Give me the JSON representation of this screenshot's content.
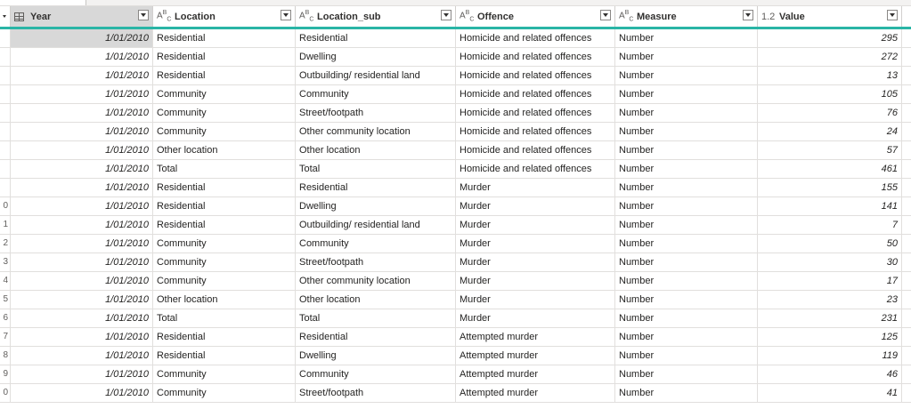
{
  "columns": [
    {
      "type_icon": "table-icon",
      "name": "Year"
    },
    {
      "type_icon": "text-type-icon",
      "name": "Location"
    },
    {
      "type_icon": "text-type-icon",
      "name": "Location_sub"
    },
    {
      "type_icon": "text-type-icon",
      "name": "Offence"
    },
    {
      "type_icon": "text-type-icon",
      "name": "Measure"
    },
    {
      "type_icon": "decimal-type-icon",
      "name": "Value"
    }
  ],
  "rows": [
    {
      "n": "",
      "year": "1/01/2010",
      "loc": "Residential",
      "sub": "Residential",
      "off": "Homicide and related offences",
      "meas": "Number",
      "val": "295"
    },
    {
      "n": "",
      "year": "1/01/2010",
      "loc": "Residential",
      "sub": "Dwelling",
      "off": "Homicide and related offences",
      "meas": "Number",
      "val": "272"
    },
    {
      "n": "",
      "year": "1/01/2010",
      "loc": "Residential",
      "sub": "Outbuilding/ residential land",
      "off": "Homicide and related offences",
      "meas": "Number",
      "val": "13"
    },
    {
      "n": "",
      "year": "1/01/2010",
      "loc": "Community",
      "sub": "Community",
      "off": "Homicide and related offences",
      "meas": "Number",
      "val": "105"
    },
    {
      "n": "",
      "year": "1/01/2010",
      "loc": "Community",
      "sub": "Street/footpath",
      "off": "Homicide and related offences",
      "meas": "Number",
      "val": "76"
    },
    {
      "n": "",
      "year": "1/01/2010",
      "loc": "Community",
      "sub": "Other community location",
      "off": "Homicide and related offences",
      "meas": "Number",
      "val": "24"
    },
    {
      "n": "",
      "year": "1/01/2010",
      "loc": "Other location",
      "sub": "Other location",
      "off": "Homicide and related offences",
      "meas": "Number",
      "val": "57"
    },
    {
      "n": "",
      "year": "1/01/2010",
      "loc": "Total",
      "sub": "Total",
      "off": "Homicide and related offences",
      "meas": "Number",
      "val": "461"
    },
    {
      "n": "",
      "year": "1/01/2010",
      "loc": "Residential",
      "sub": "Residential",
      "off": "Murder",
      "meas": "Number",
      "val": "155"
    },
    {
      "n": "0",
      "year": "1/01/2010",
      "loc": "Residential",
      "sub": "Dwelling",
      "off": "Murder",
      "meas": "Number",
      "val": "141"
    },
    {
      "n": "1",
      "year": "1/01/2010",
      "loc": "Residential",
      "sub": "Outbuilding/ residential land",
      "off": "Murder",
      "meas": "Number",
      "val": "7"
    },
    {
      "n": "2",
      "year": "1/01/2010",
      "loc": "Community",
      "sub": "Community",
      "off": "Murder",
      "meas": "Number",
      "val": "50"
    },
    {
      "n": "3",
      "year": "1/01/2010",
      "loc": "Community",
      "sub": "Street/footpath",
      "off": "Murder",
      "meas": "Number",
      "val": "30"
    },
    {
      "n": "4",
      "year": "1/01/2010",
      "loc": "Community",
      "sub": "Other community location",
      "off": "Murder",
      "meas": "Number",
      "val": "17"
    },
    {
      "n": "5",
      "year": "1/01/2010",
      "loc": "Other location",
      "sub": "Other location",
      "off": "Murder",
      "meas": "Number",
      "val": "23"
    },
    {
      "n": "6",
      "year": "1/01/2010",
      "loc": "Total",
      "sub": "Total",
      "off": "Murder",
      "meas": "Number",
      "val": "231"
    },
    {
      "n": "7",
      "year": "1/01/2010",
      "loc": "Residential",
      "sub": "Residential",
      "off": "Attempted murder",
      "meas": "Number",
      "val": "125"
    },
    {
      "n": "8",
      "year": "1/01/2010",
      "loc": "Residential",
      "sub": "Dwelling",
      "off": "Attempted murder",
      "meas": "Number",
      "val": "119"
    },
    {
      "n": "9",
      "year": "1/01/2010",
      "loc": "Community",
      "sub": "Community",
      "off": "Attempted murder",
      "meas": "Number",
      "val": "46"
    },
    {
      "n": "0",
      "year": "1/01/2010",
      "loc": "Community",
      "sub": "Street/footpath",
      "off": "Attempted murder",
      "meas": "Number",
      "val": "41"
    }
  ],
  "colors": {
    "accent": "#2ab5a6",
    "selected": "#d8d8d8",
    "grid": "#e1dfdd"
  }
}
